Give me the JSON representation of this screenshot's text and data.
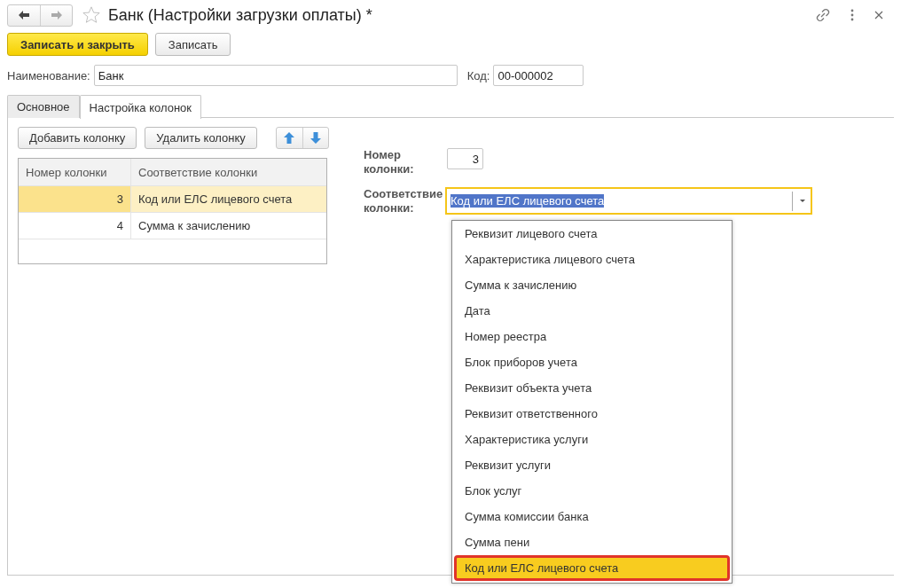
{
  "window": {
    "title": "Банк (Настройки загрузки оплаты) *",
    "starred": false
  },
  "toolbar": {
    "buttons": [
      {
        "label": "Записать и закрыть",
        "kind": "primary"
      },
      {
        "label": "Записать",
        "kind": "normal"
      }
    ]
  },
  "fields": {
    "name": {
      "label": "Наименование:",
      "value": "Банк"
    },
    "code": {
      "label": "Код:",
      "value": "00-000002"
    }
  },
  "tabs": [
    {
      "label": "Основное",
      "selected": false
    },
    {
      "label": "Настройка колонок",
      "selected": true
    }
  ],
  "column_buttons": [
    "Добавить колонку",
    "Удалить колонку"
  ],
  "table": {
    "columns": [
      "Номер колонки",
      "Соответствие колонки"
    ],
    "rows": [
      {
        "number": "3",
        "mapping": "Код или ЕЛС лицевого счета",
        "selected": true
      },
      {
        "number": "4",
        "mapping": "Сумма к зачислению",
        "selected": false
      }
    ]
  },
  "detail": {
    "number_label": "Номер колонки:",
    "number_value": "3",
    "mapping_label": "Соответствие колонки:",
    "mapping_value": "Код или ЕЛС лицевого счета",
    "mapping_text_selected": true
  },
  "dropdown": {
    "items": [
      {
        "label": "Реквизит лицевого счета",
        "selected": false,
        "annotated": false
      },
      {
        "label": "Характеристика лицевого счета",
        "selected": false,
        "annotated": false
      },
      {
        "label": "Сумма к зачислению",
        "selected": false,
        "annotated": false
      },
      {
        "label": "Дата",
        "selected": false,
        "annotated": false
      },
      {
        "label": "Номер реестра",
        "selected": false,
        "annotated": false
      },
      {
        "label": "Блок приборов учета",
        "selected": false,
        "annotated": false
      },
      {
        "label": "Реквизит объекта учета",
        "selected": false,
        "annotated": false
      },
      {
        "label": "Реквизит ответственного",
        "selected": false,
        "annotated": false
      },
      {
        "label": "Характеристика услуги",
        "selected": false,
        "annotated": false
      },
      {
        "label": "Реквизит услуги",
        "selected": false,
        "annotated": false
      },
      {
        "label": "Блок услуг",
        "selected": false,
        "annotated": false
      },
      {
        "label": "Сумма комиссии банка",
        "selected": false,
        "annotated": false
      },
      {
        "label": "Сумма пени",
        "selected": false,
        "annotated": false
      },
      {
        "label": "Код или ЕЛС лицевого счета",
        "selected": true,
        "annotated": true
      }
    ]
  }
}
